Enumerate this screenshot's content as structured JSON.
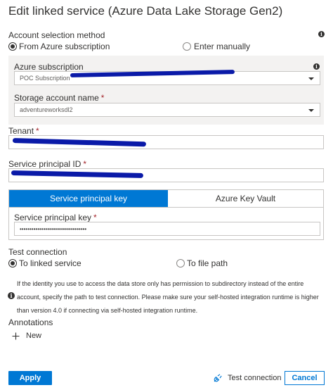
{
  "title": "Edit linked service (Azure Data Lake Storage Gen2)",
  "account_selection": {
    "label": "Account selection method",
    "options": [
      "From Azure subscription",
      "Enter manually"
    ],
    "selected": "From Azure subscription"
  },
  "subscription": {
    "label": "Azure subscription",
    "value": "POC Subscription"
  },
  "storage_account": {
    "label": "Storage account name",
    "required": "*",
    "value": "adventureworksdl2"
  },
  "tenant": {
    "label": "Tenant",
    "required": "*"
  },
  "service_principal_id": {
    "label": "Service principal ID",
    "required": "*"
  },
  "auth_tabs": {
    "active": "Service principal key",
    "inactive": "Azure Key Vault"
  },
  "service_principal_key": {
    "label": "Service principal key",
    "required": "*",
    "value": "••••••••••••••••••••••••••••••••••"
  },
  "test_connection": {
    "label": "Test connection",
    "options": [
      "To linked service",
      "To file path"
    ],
    "selected": "To linked service",
    "note": "If the identity you use to access the data store only has permission to subdirectory instead of the entire account, specify the path to test connection. Please make sure your self-hosted integration runtime is higher than version 4.0 if connecting via self-hosted integration runtime."
  },
  "annotations": {
    "label": "Annotations",
    "new_label": "New"
  },
  "footer": {
    "apply": "Apply",
    "test": "Test connection",
    "cancel": "Cancel"
  },
  "colors": {
    "accent": "#0078d4",
    "redaction": "#0a1aa8",
    "panel": "#f3f2f1"
  },
  "icons": [
    "info-icon",
    "chevron-down-icon",
    "plus-icon",
    "plug-icon"
  ]
}
